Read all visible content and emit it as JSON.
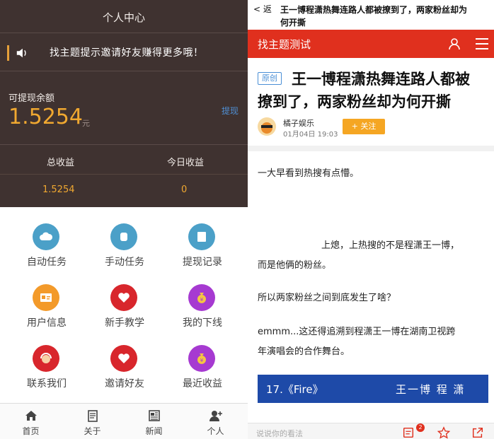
{
  "left": {
    "header_title": "个人中心",
    "notice_text": "找主题提示邀请好友赚得更多哦！",
    "balance_label": "可提现余额",
    "balance_value": "1.5254",
    "balance_unit": "元",
    "withdraw_label": "提现",
    "stats": [
      {
        "label": "总收益",
        "value": "1.5254"
      },
      {
        "label": "今日收益",
        "value": "0"
      }
    ],
    "grid": [
      {
        "label": "自动任务",
        "icon": "cloud-icon",
        "color": "#4ba0c8"
      },
      {
        "label": "手动任务",
        "icon": "hand-icon",
        "color": "#4ba0c8"
      },
      {
        "label": "提现记录",
        "icon": "record-icon",
        "color": "#4ba0c8"
      },
      {
        "label": "用户信息",
        "icon": "id-card-icon",
        "color": "#f39a2a"
      },
      {
        "label": "新手教学",
        "icon": "heart-icon",
        "color": "#d8262c"
      },
      {
        "label": "我的下线",
        "icon": "money-bag-icon",
        "color": "#a63ad1"
      },
      {
        "label": "联系我们",
        "icon": "headset-icon",
        "color": "#d8262c"
      },
      {
        "label": "邀请好友",
        "icon": "heart-icon",
        "color": "#d8262c"
      },
      {
        "label": "最近收益",
        "icon": "money-bag-icon",
        "color": "#a63ad1"
      }
    ],
    "tabs": [
      {
        "label": "首页",
        "icon": "home-icon"
      },
      {
        "label": "关于",
        "icon": "document-icon"
      },
      {
        "label": "新闻",
        "icon": "news-icon"
      },
      {
        "label": "个人",
        "icon": "user-add-icon"
      }
    ]
  },
  "right": {
    "back_label": "< 返",
    "title_line1": "王一博程潇热舞连路人都被撩到了，两家粉丝却为",
    "title_line2": "何开撕",
    "brand": "找主题测试",
    "badge": "原创",
    "headline_line1": "王一博程潇热舞连路人都被",
    "headline_line2": "撩到了，两家粉丝却为何开撕",
    "author": "橘子娱乐",
    "date": "01月04日 19:03",
    "follow_label": "+ 关注",
    "paragraphs": [
      "一大早看到热搜有点懵。",
      "上熄，上热搜的不是程潇王一博，",
      "而是他俩的粉丝。",
      "所以两家粉丝之间到底发生了啥？",
      "emmm...这还得追溯到程潇王一博在湖南卫视跨",
      "年演唱会的合作舞台。"
    ],
    "banner_left": "17.《Fire》",
    "banner_right": "王一博  程  潇",
    "comment_placeholder": "说说你的看法",
    "comment_count": "2"
  }
}
